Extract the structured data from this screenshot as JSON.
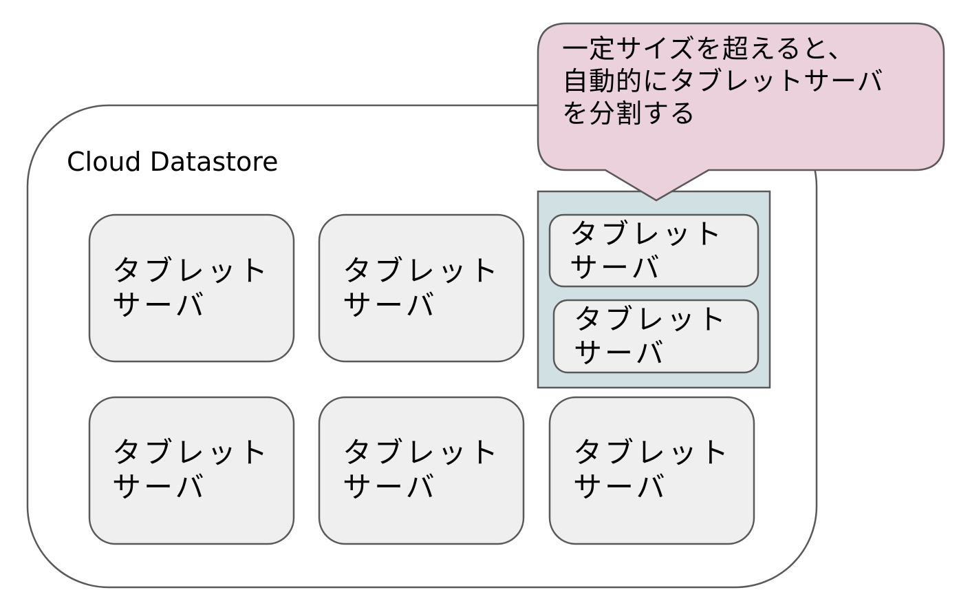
{
  "container": {
    "title": "Cloud Datastore"
  },
  "servers": {
    "row1": [
      {
        "line1": "タブレット",
        "line2": "サーバ"
      },
      {
        "line1": "タブレット",
        "line2": "サーバ"
      }
    ],
    "split": [
      {
        "line1": "タブレット",
        "line2": "サーバ"
      },
      {
        "line1": "タブレット",
        "line2": "サーバ"
      }
    ],
    "row2": [
      {
        "line1": "タブレット",
        "line2": "サーバ"
      },
      {
        "line1": "タブレット",
        "line2": "サーバ"
      },
      {
        "line1": "タブレット",
        "line2": "サーバ"
      }
    ]
  },
  "callout": {
    "lines": [
      "一定サイズを超えると、",
      "自動的にタブレットサーバ",
      "を分割する"
    ]
  },
  "colors": {
    "server_fill": "#efefef",
    "server_stroke": "#595959",
    "split_group_fill": "#d1e0e3",
    "callout_fill": "#ead1dc",
    "container_stroke": "#595959"
  }
}
